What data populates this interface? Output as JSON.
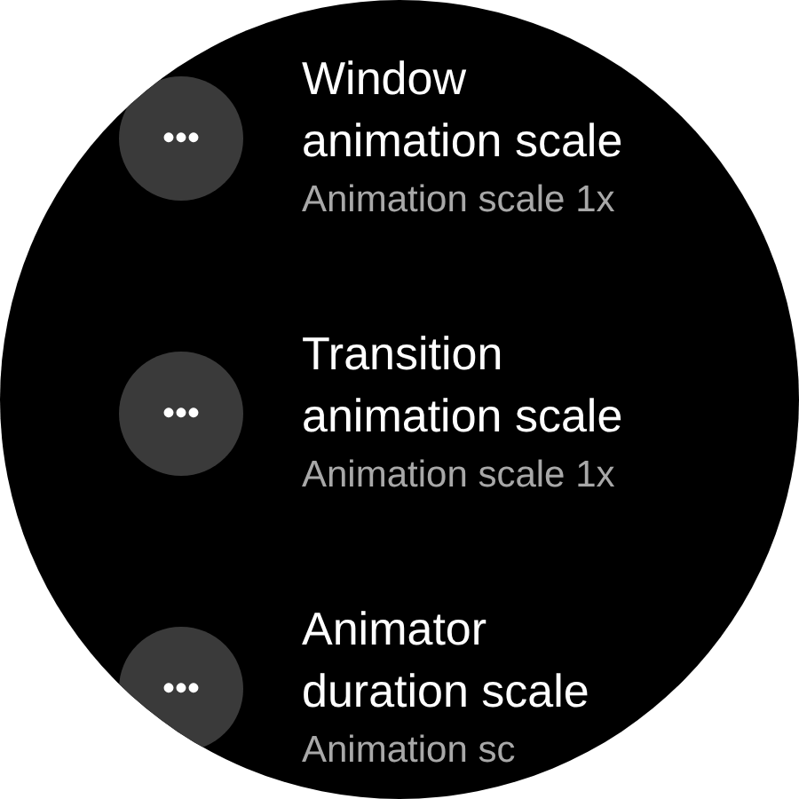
{
  "items": [
    {
      "title": "Window animation scale",
      "subtitle": "Animation scale 1x",
      "icon": "•••"
    },
    {
      "title": "Transition animation scale",
      "subtitle": "Animation scale 1x",
      "icon": "•••"
    },
    {
      "title": "Animator duration scale",
      "subtitle": "Animation sc",
      "icon": "•••"
    }
  ]
}
